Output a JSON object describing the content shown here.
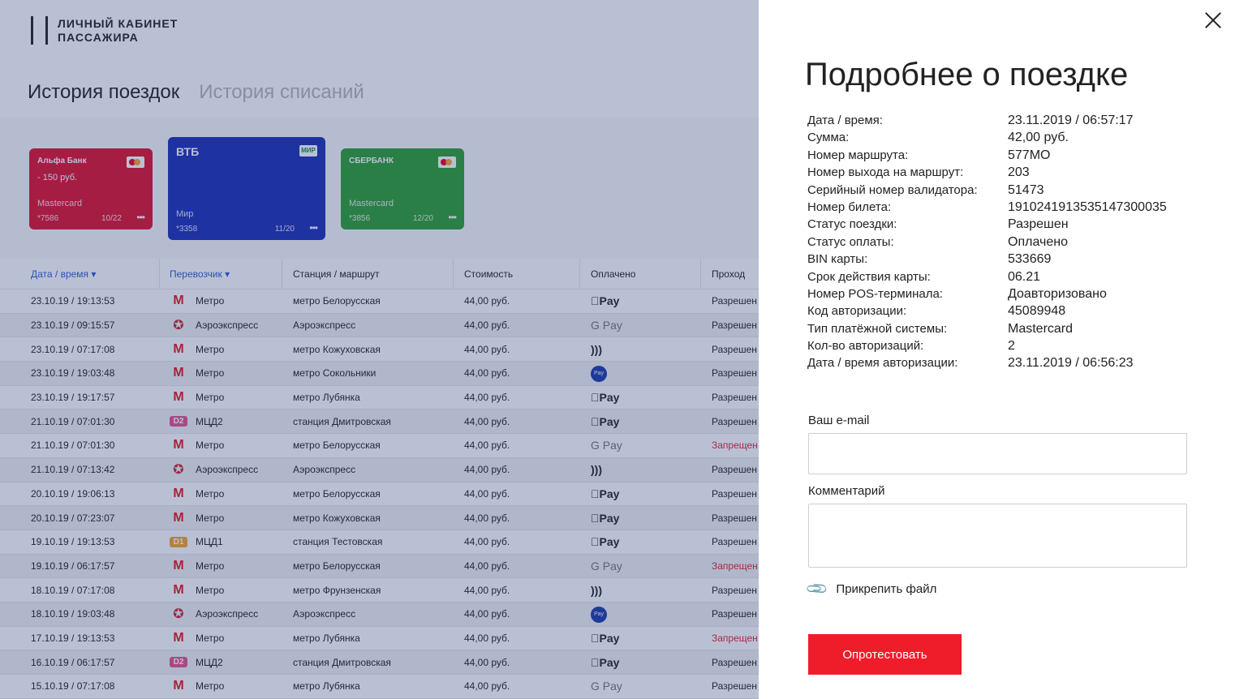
{
  "logo": {
    "line1": "ЛИЧНЫЙ КАБИНЕТ",
    "line2": "ПАССАЖИРА"
  },
  "tabs": [
    {
      "label": "История поездок",
      "active": true
    },
    {
      "label": "История списаний",
      "active": false
    }
  ],
  "cards": [
    {
      "bank": "Альфа Банк",
      "amount": "- 150 руб.",
      "type": "Mastercard",
      "number": "*7586",
      "expiry": "10/22",
      "color": "#e1102a"
    },
    {
      "bank": "ВТБ",
      "amount": "",
      "type": "Мир",
      "number": "*3358",
      "expiry": "11/20",
      "color": "#1a2eb5",
      "mir_logo": "МИР"
    },
    {
      "bank": "СБЕРБАНК",
      "amount": "",
      "type": "Mastercard",
      "number": "*3856",
      "expiry": "12/20",
      "color": "#2b9f2e"
    }
  ],
  "table": {
    "headers": [
      "Дата / время",
      "Перевозчик",
      "Станция / маршрут",
      "Стоимость",
      "Оплачено",
      "Проход"
    ],
    "rows": [
      {
        "date": "23.10.19 / 19:13:53",
        "carrier": "Метро",
        "icon": "metro",
        "station": "метро Белорусская",
        "price": "44,00 руб.",
        "paid": "Pay",
        "paid_icon": "apple-pay",
        "pass": "Разрешен"
      },
      {
        "date": "23.10.19 / 09:15:57",
        "carrier": "Аэроэкспресс",
        "icon": "aero",
        "station": "Аэроэкспресс",
        "price": "44,00 руб.",
        "paid": "G Pay",
        "paid_icon": "google-pay",
        "pass": "Разрешен"
      },
      {
        "date": "23.10.19 / 07:17:08",
        "carrier": "Метро",
        "icon": "metro",
        "station": "метро Кожуховская",
        "price": "44,00 руб.",
        "paid": ")))",
        "paid_icon": "contactless",
        "pass": "Разрешен"
      },
      {
        "date": "23.10.19 / 19:03:48",
        "carrier": "Метро",
        "icon": "metro",
        "station": "метро Сокольники",
        "price": "44,00 руб.",
        "paid": "Pay",
        "paid_icon": "paypass",
        "pass": "Разрешен"
      },
      {
        "date": "23.10.19 / 19:17:57",
        "carrier": "Метро",
        "icon": "metro",
        "station": "метро Лубянка",
        "price": "44,00 руб.",
        "paid": "Pay",
        "paid_icon": "apple-pay",
        "pass": "Разрешен"
      },
      {
        "date": "21.10.19 / 07:01:30",
        "carrier": "МЦД2",
        "icon": "D2",
        "station": "станция Дмитровская",
        "price": "44,00 руб.",
        "paid": "Pay",
        "paid_icon": "apple-pay",
        "pass": "Разрешен"
      },
      {
        "date": "21.10.19 / 07:01:30",
        "carrier": "Метро",
        "icon": "metro",
        "station": "метро Белорусская",
        "price": "44,00 руб.",
        "paid": "G Pay",
        "paid_icon": "google-pay",
        "pass": "Запрещен"
      },
      {
        "date": "21.10.19 / 07:13:42",
        "carrier": "Аэроэкспресс",
        "icon": "aero",
        "station": "Аэроэкспресс",
        "price": "44,00 руб.",
        "paid": ")))",
        "paid_icon": "contactless",
        "pass": "Разрешен"
      },
      {
        "date": "20.10.19 / 19:06:13",
        "carrier": "Метро",
        "icon": "metro",
        "station": "метро Белорусская",
        "price": "44,00 руб.",
        "paid": "Pay",
        "paid_icon": "apple-pay",
        "pass": "Разрешен"
      },
      {
        "date": "20.10.19 / 07:23:07",
        "carrier": "Метро",
        "icon": "metro",
        "station": "метро Кожуховская",
        "price": "44,00 руб.",
        "paid": "Pay",
        "paid_icon": "apple-pay",
        "pass": "Разрешен"
      },
      {
        "date": "19.10.19 / 19:13:53",
        "carrier": "МЦД1",
        "icon": "D1",
        "station": "станция Тестовская",
        "price": "44,00 руб.",
        "paid": "Pay",
        "paid_icon": "apple-pay",
        "pass": "Разрешен"
      },
      {
        "date": "19.10.19 / 06:17:57",
        "carrier": "Метро",
        "icon": "metro",
        "station": "метро Белорусская",
        "price": "44,00 руб.",
        "paid": "G Pay",
        "paid_icon": "google-pay",
        "pass": "Запрещен"
      },
      {
        "date": "18.10.19 / 07:17:08",
        "carrier": "Метро",
        "icon": "metro",
        "station": "метро Фрунзенская",
        "price": "44,00 руб.",
        "paid": ")))",
        "paid_icon": "contactless",
        "pass": "Разрешен"
      },
      {
        "date": "18.10.19 / 19:03:48",
        "carrier": "Аэроэкспресс",
        "icon": "aero",
        "station": "Аэроэкспресс",
        "price": "44,00 руб.",
        "paid": "Pay",
        "paid_icon": "paypass",
        "pass": "Разрешен"
      },
      {
        "date": "17.10.19 / 19:13:53",
        "carrier": "Метро",
        "icon": "metro",
        "station": "метро Лубянка",
        "price": "44,00 руб.",
        "paid": "Pay",
        "paid_icon": "apple-pay",
        "pass": "Запрещен"
      },
      {
        "date": "16.10.19 / 06:17:57",
        "carrier": "МЦД2",
        "icon": "D2",
        "station": "станция Дмитровская",
        "price": "44,00 руб.",
        "paid": "Pay",
        "paid_icon": "apple-pay",
        "pass": "Разрешен"
      },
      {
        "date": "15.10.19 / 07:17:08",
        "carrier": "Метро",
        "icon": "metro",
        "station": "метро Лубянка",
        "price": "44,00 руб.",
        "paid": "G Pay",
        "paid_icon": "google-pay",
        "pass": "Разрешен"
      }
    ]
  },
  "panel": {
    "title": "Подробнее о поездке",
    "details": [
      {
        "label": "Дата / время:",
        "value": "23.11.2019 / 06:57:17"
      },
      {
        "label": "Сумма:",
        "value": "42,00  руб."
      },
      {
        "label": "Номер маршрута:",
        "value": "577МО"
      },
      {
        "label": "Номер выхода на маршрут:",
        "value": "203"
      },
      {
        "label": "Серийный номер валидатора:",
        "value": "51473"
      },
      {
        "label": "Номер билета:",
        "value": "1910241913535147300035"
      },
      {
        "label": "Статус поездки:",
        "value": "Разрешен"
      },
      {
        "label": "Статус оплаты:",
        "value": "Оплачено"
      },
      {
        "label": "BIN карты:",
        "value": "533669"
      },
      {
        "label": "Срок действия карты:",
        "value": "06.21"
      },
      {
        "label": "Номер POS-терминала:",
        "value": "Доавторизовано"
      },
      {
        "label": "Код авторизации:",
        "value": "45089948"
      },
      {
        "label": "Тип платёжной системы:",
        "value": "Mastercard"
      },
      {
        "label": "Кол-во авторизаций:",
        "value": "2"
      },
      {
        "label": "Дата / время авторизации:",
        "value": "23.11.2019 / 06:56:23"
      }
    ],
    "email_label": "Ваш e-mail",
    "email_value": "",
    "comment_label": "Комментарий",
    "comment_value": "",
    "attach_label": "Прикрепить файл",
    "submit_label": "Опротестовать"
  },
  "colors": {
    "accent": "#ef1c2a",
    "link": "#2a5bd7",
    "denied": "#e8202e"
  }
}
